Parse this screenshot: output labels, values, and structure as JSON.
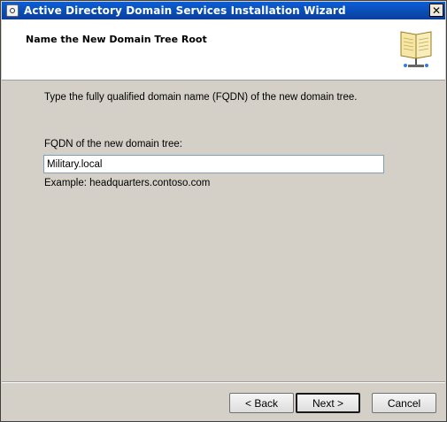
{
  "window": {
    "title": "Active Directory Domain Services Installation Wizard",
    "close_label": "✕"
  },
  "header": {
    "title": "Name the New Domain Tree Root",
    "icon": "book-icon"
  },
  "content": {
    "instruction": "Type the fully qualified domain name (FQDN) of the new domain tree.",
    "fqdn_label": "FQDN of the new domain tree:",
    "fqdn_value": "Military.local",
    "example": "Example: headquarters.contoso.com"
  },
  "buttons": {
    "back": "< Back",
    "next": "Next >",
    "cancel": "Cancel"
  },
  "colors": {
    "titlebar": "#0a4ec2",
    "dialog_bg": "#d4d0c8",
    "header_bg": "#ffffff"
  }
}
